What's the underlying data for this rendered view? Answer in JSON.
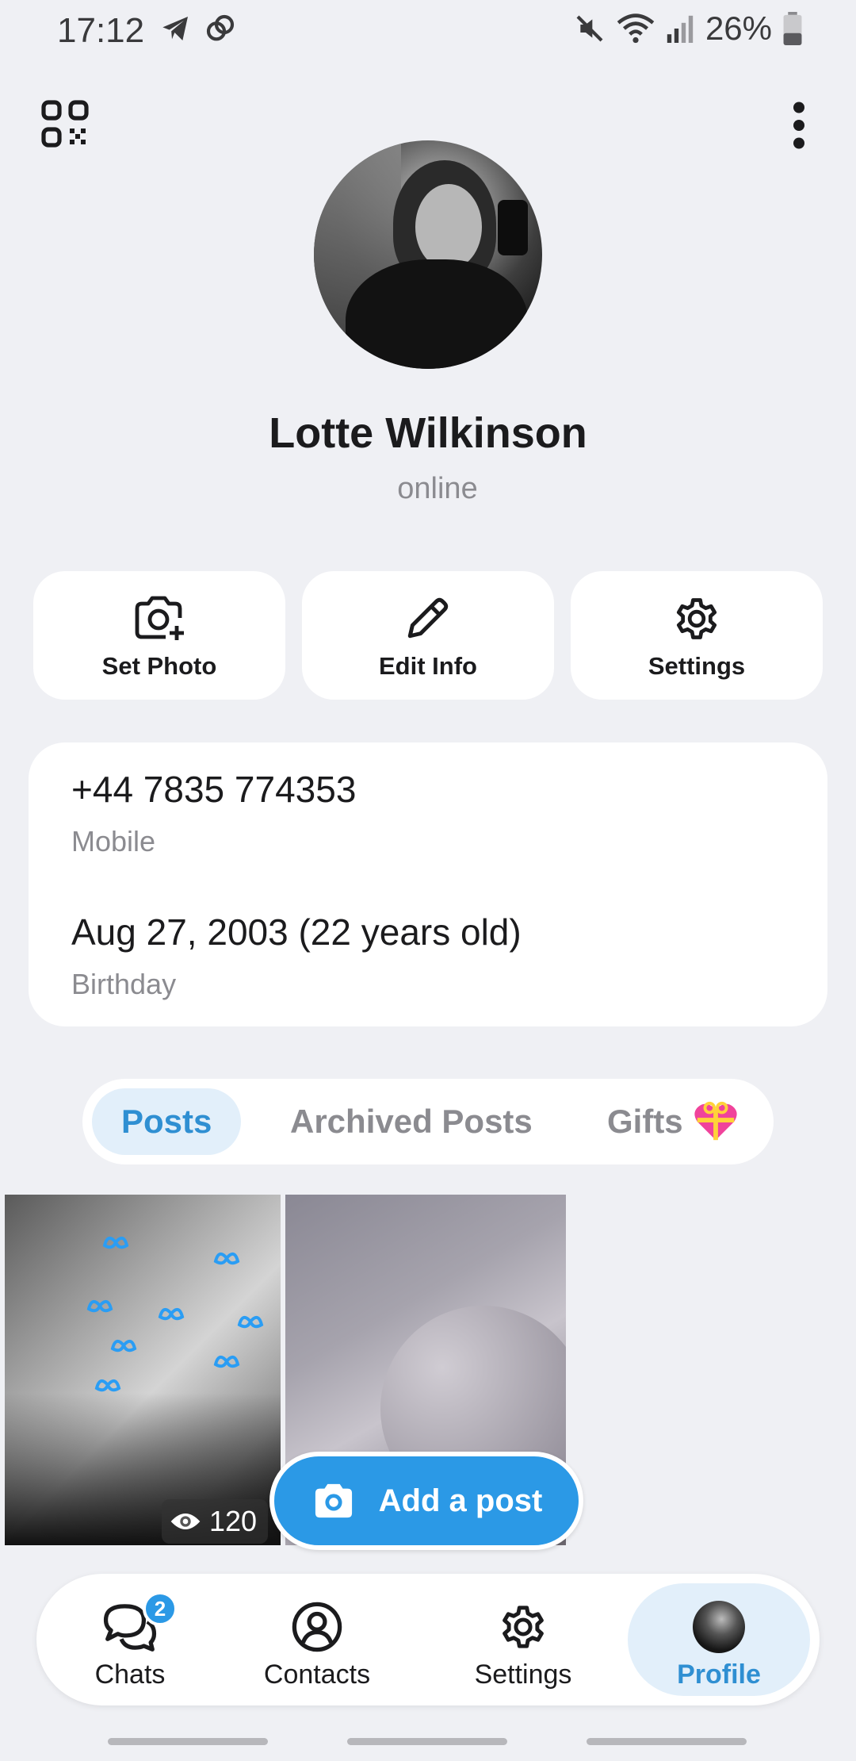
{
  "status_bar": {
    "time": "17:12",
    "battery": "26%"
  },
  "profile": {
    "name": "Lotte Wilkinson",
    "status": "online"
  },
  "actions": [
    {
      "label": "Set Photo",
      "icon": "camera-plus-icon"
    },
    {
      "label": "Edit Info",
      "icon": "pencil-icon"
    },
    {
      "label": "Settings",
      "icon": "gear-icon"
    }
  ],
  "info": {
    "phone": "+44 7835 774353",
    "phone_label": "Mobile",
    "birthday": "Aug 27, 2003 (22 years old)",
    "birthday_label": "Birthday"
  },
  "tabs": [
    {
      "label": "Posts",
      "active": true
    },
    {
      "label": "Archived Posts",
      "active": false
    },
    {
      "label": "Gifts",
      "active": false
    }
  ],
  "posts": [
    {
      "views": "120"
    },
    {}
  ],
  "add_post": {
    "label": "Add a post"
  },
  "nav": [
    {
      "label": "Chats",
      "badge": "2",
      "icon": "chat-bubbles-icon"
    },
    {
      "label": "Contacts",
      "icon": "person-circle-icon"
    },
    {
      "label": "Settings",
      "icon": "gear-icon"
    },
    {
      "label": "Profile",
      "active": true,
      "icon": "avatar-icon"
    }
  ],
  "colors": {
    "accent": "#2b99e6",
    "background": "#eff0f4",
    "active_tab_bg": "#e2effa"
  }
}
